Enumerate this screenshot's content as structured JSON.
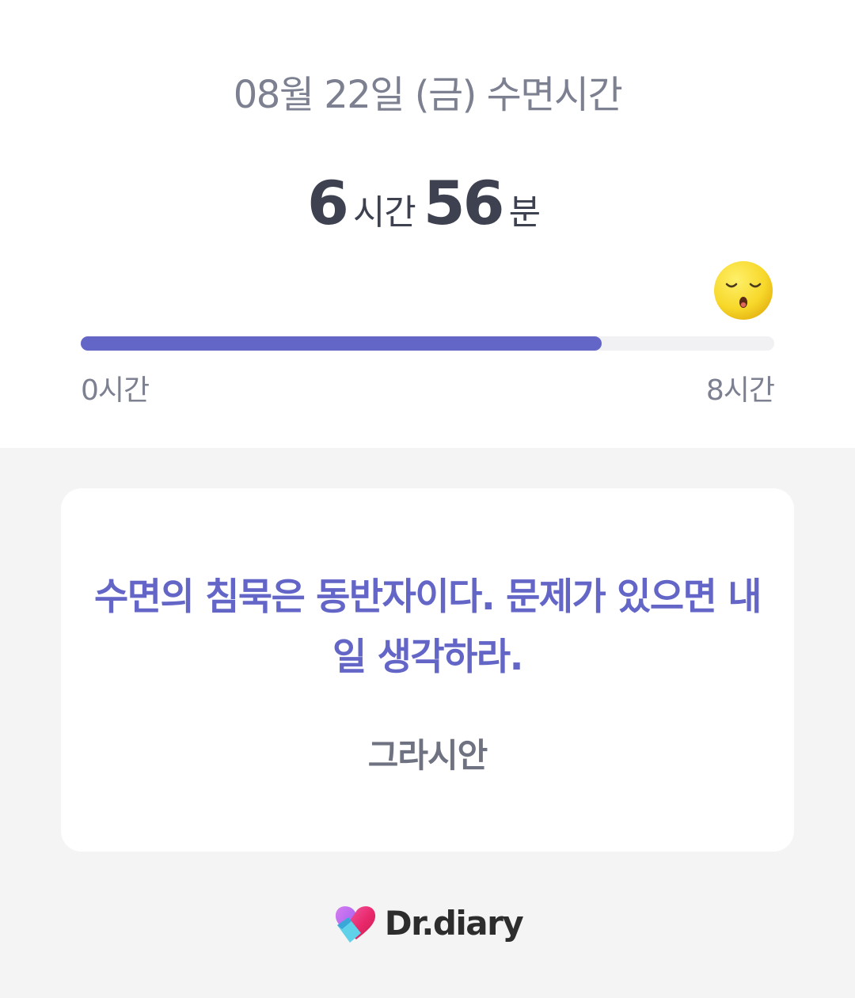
{
  "header": {
    "title": "08월 22일 (금) 수면시간"
  },
  "sleep": {
    "hours": "6",
    "hours_unit": "시간",
    "minutes": "56",
    "minutes_unit": "분",
    "progress_fraction": 0.7508,
    "range_min_label": "0시간",
    "range_max_label": "8시간",
    "status_icon": "sleeping-face-icon"
  },
  "quote_card": {
    "text": "수면의 침묵은 동반자이다. 문제가 있으면 내일 생각하라.",
    "author": "그라시안"
  },
  "footer": {
    "brand_name": "Dr.diary",
    "logo_icon": "heart-logo-icon"
  },
  "colors": {
    "accent": "#6366c7",
    "page_background": "#f4f4f4",
    "track": "#f1f1f3",
    "text_primary": "#3d4150",
    "text_secondary": "#7d8090"
  }
}
